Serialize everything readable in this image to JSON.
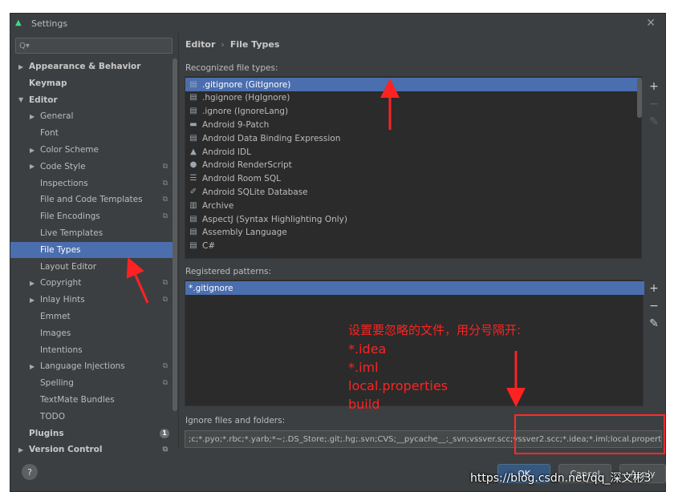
{
  "window": {
    "title": "Settings",
    "close_symbol": "✕"
  },
  "search": {
    "placeholder": "Q▾"
  },
  "sidebar": {
    "items": [
      {
        "label": "Appearance & Behavior",
        "arrow": "▶",
        "level": 0,
        "bold": true
      },
      {
        "label": "Keymap",
        "arrow": "",
        "level": 0,
        "bold": true
      },
      {
        "label": "Editor",
        "arrow": "▼",
        "level": 0,
        "bold": true
      },
      {
        "label": "General",
        "arrow": "▶",
        "level": 1
      },
      {
        "label": "Font",
        "arrow": "",
        "level": 1
      },
      {
        "label": "Color Scheme",
        "arrow": "▶",
        "level": 1
      },
      {
        "label": "Code Style",
        "arrow": "▶",
        "level": 1,
        "project_icon": true
      },
      {
        "label": "Inspections",
        "arrow": "",
        "level": 1,
        "project_icon": true
      },
      {
        "label": "File and Code Templates",
        "arrow": "",
        "level": 1,
        "project_icon": true
      },
      {
        "label": "File Encodings",
        "arrow": "",
        "level": 1,
        "project_icon": true
      },
      {
        "label": "Live Templates",
        "arrow": "",
        "level": 1
      },
      {
        "label": "File Types",
        "arrow": "",
        "level": 1,
        "selected": true
      },
      {
        "label": "Layout Editor",
        "arrow": "",
        "level": 1
      },
      {
        "label": "Copyright",
        "arrow": "▶",
        "level": 1,
        "project_icon": true
      },
      {
        "label": "Inlay Hints",
        "arrow": "▶",
        "level": 1,
        "project_icon": true
      },
      {
        "label": "Emmet",
        "arrow": "",
        "level": 1
      },
      {
        "label": "Images",
        "arrow": "",
        "level": 1
      },
      {
        "label": "Intentions",
        "arrow": "",
        "level": 1
      },
      {
        "label": "Language Injections",
        "arrow": "▶",
        "level": 1,
        "project_icon": true
      },
      {
        "label": "Spelling",
        "arrow": "",
        "level": 1,
        "project_icon": true
      },
      {
        "label": "TextMate Bundles",
        "arrow": "",
        "level": 1
      },
      {
        "label": "TODO",
        "arrow": "",
        "level": 1
      },
      {
        "label": "Plugins",
        "arrow": "",
        "level": 0,
        "bold": true,
        "badge": "1"
      },
      {
        "label": "Version Control",
        "arrow": "▶",
        "level": 0,
        "bold": true,
        "project_icon": true
      }
    ],
    "project_icon_glyph": "⧉"
  },
  "breadcrumb": {
    "parent": "Editor",
    "separator": "›",
    "current": "File Types"
  },
  "recognized": {
    "label": "Recognized file types:",
    "items": [
      {
        "label": ".gitignore (GitIgnore)",
        "icon": "file-icon",
        "selected": true
      },
      {
        "label": ".hgignore (HgIgnore)",
        "icon": "file-icon"
      },
      {
        "label": ".ignore (IgnoreLang)",
        "icon": "file-icon"
      },
      {
        "label": "Android 9-Patch",
        "icon": "folder-icon"
      },
      {
        "label": "Android Data Binding Expression",
        "icon": "file-icon"
      },
      {
        "label": "Android IDL",
        "icon": "android-icon"
      },
      {
        "label": "Android RenderScript",
        "icon": "globe-icon"
      },
      {
        "label": "Android Room SQL",
        "icon": "list-icon"
      },
      {
        "label": "Android SQLite Database",
        "icon": "pen-icon"
      },
      {
        "label": "Archive",
        "icon": "archive-icon"
      },
      {
        "label": "AspectJ (Syntax Highlighting Only)",
        "icon": "file-icon"
      },
      {
        "label": "Assembly Language",
        "icon": "file-icon"
      },
      {
        "label": "C#",
        "icon": "file-icon"
      }
    ]
  },
  "tools": {
    "add": "+",
    "remove": "−",
    "edit": "✎"
  },
  "patterns": {
    "label": "Registered patterns:",
    "items": [
      {
        "label": "*.gitignore",
        "selected": true
      }
    ]
  },
  "annotation": {
    "lines": [
      "设置要忽略的文件，用分号隔开:",
      "*.idea",
      "*.iml",
      "local.properties",
      "build"
    ]
  },
  "ignore": {
    "label": "Ignore files and folders:",
    "value": ";c;*.pyo;*.rbc;*.yarb;*~;.DS_Store;.git;.hg;.svn;CVS;__pycache__;_svn;vssver.scc;vssver2.scc;*.idea;*.iml;local.properties;build;"
  },
  "footer": {
    "help": "?",
    "ok": "OK",
    "cancel": "Cancel",
    "apply": "Apply"
  },
  "watermark": "https://blog.csdn.net/qq_深文彬3",
  "colors": {
    "selection": "#4b6eaf",
    "annotation": "#ff2222",
    "panel": "#3c3f41",
    "list_bg": "#2b2b2b"
  }
}
